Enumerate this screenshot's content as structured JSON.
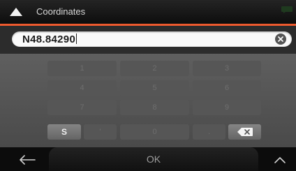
{
  "header": {
    "title": "Coordinates",
    "back_icon": "chevron-up-icon",
    "status_icon": "speech-bubble-icon"
  },
  "input": {
    "value": "N48.84290",
    "clear_icon": "clear-x-icon"
  },
  "keypad": {
    "keys": {
      "k1": "1",
      "k2": "2",
      "k3": "3",
      "k4": "4",
      "k5": "5",
      "k6": "6",
      "k7": "7",
      "k8": "8",
      "k9": "9",
      "ks": "S",
      "kquote": "'",
      "k0": "0",
      "kdot": "."
    },
    "backspace_icon": "backspace-icon"
  },
  "footer": {
    "ok_label": "OK",
    "back_icon": "arrow-left-icon",
    "menu_icon": "chevron-up-icon"
  },
  "colors": {
    "accent": "#ee5a2e",
    "background": "#1a1a1a",
    "keypad_bg": "#555555",
    "input_bg": "#fafafa"
  }
}
